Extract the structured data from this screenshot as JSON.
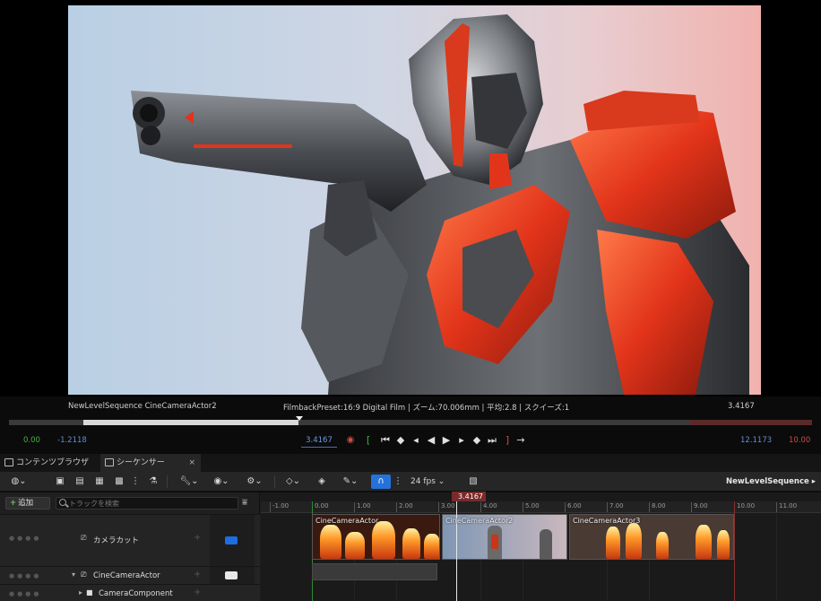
{
  "viewport": {
    "info_left": "NewLevelSequence  CineCameraActor2",
    "info_center": "FilmbackPreset:16:9 Digital Film | ズーム:70.006mm | 平均:2.8 | スクイーズ:1",
    "info_right": "3.4167"
  },
  "transport": {
    "start_green": "0.00",
    "start_range": "-1.2118",
    "current_time": "3.4167",
    "end_range": "12.1173",
    "end_red": "10.00",
    "icons": [
      "record-icon",
      "set-start-icon",
      "jump-start-icon",
      "prev-key-icon",
      "step-back-icon",
      "play-reverse-icon",
      "play-icon",
      "step-forward-icon",
      "next-key-icon",
      "jump-end-icon",
      "set-end-icon",
      "loop-icon"
    ]
  },
  "tabs": [
    {
      "label": "コンテンツブラウザ"
    },
    {
      "label": "シーケンサー"
    }
  ],
  "toolbar": {
    "fps": "24 fps",
    "sequence_name": "NewLevelSequence"
  },
  "outliner": {
    "add_label": "追加",
    "search_placeholder": "トラックを検索",
    "rows": [
      {
        "label": "カメラカット"
      },
      {
        "label": "CineCameraActor"
      },
      {
        "label": "CameraComponent"
      }
    ]
  },
  "timeline": {
    "playhead": "3.4167",
    "ticks": [
      "-1.00",
      "0.00",
      "1.00",
      "2.00",
      "3.00",
      "4.00",
      "5.00",
      "6.00",
      "7.00",
      "8.00",
      "9.00",
      "10.00",
      "11.00"
    ],
    "shots": [
      {
        "name": "CineCameraActor"
      },
      {
        "name": "CineCameraActor2"
      },
      {
        "name": "CineCameraActor3"
      }
    ]
  },
  "colors": {
    "accent": "#2672d9",
    "start_marker": "#3fb33f",
    "end_marker": "#d04a4a",
    "playhead": "#7a2a2a"
  }
}
